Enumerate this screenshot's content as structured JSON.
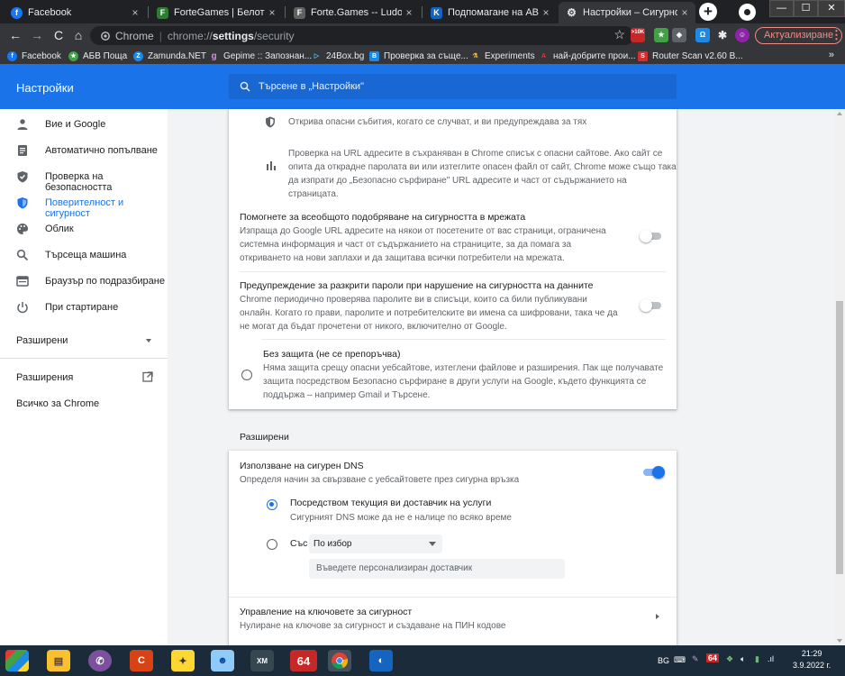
{
  "window": {
    "tabs": [
      {
        "title": "Facebook",
        "favicon": "facebook-favicon",
        "favicon_color": "#1877f2",
        "favicon_char": "f"
      },
      {
        "title": "ForteGames | Белот Играй",
        "favicon": "fortegames-favicon",
        "favicon_color": "#2e7d32",
        "favicon_char": "F"
      },
      {
        "title": "Forte.Games -- Ludo --",
        "favicon": "fortegames-ludo-favicon",
        "favicon_color": "#616161",
        "favicon_char": "F"
      },
      {
        "title": "Подпомагане на АВ прогр",
        "favicon": "k-favicon",
        "favicon_color": "#1565c0",
        "favicon_char": "K"
      },
      {
        "title": "Настройки – Сигурност",
        "favicon": "settings-gear-favicon",
        "favicon_color": "#5f6368",
        "favicon_char": "⚙"
      }
    ],
    "tab_close_glyph": "×",
    "new_tab_glyph": "+",
    "window_controls": {
      "minimize": "—",
      "maximize": "☐",
      "close": "✕"
    }
  },
  "toolbar": {
    "origin_label": "Chrome",
    "url_scheme": "chrome://",
    "url_host": "settings",
    "url_path": "/security",
    "update_label": "Актуализиране",
    "menu_glyph": "⋮",
    "badge_text": ">10K"
  },
  "bookmarks": [
    {
      "label": "Facebook",
      "color": "#1877f2",
      "char": "f"
    },
    {
      "label": "АБВ Поща",
      "color": "#43a047",
      "char": "★"
    },
    {
      "label": "Zamunda.NET",
      "color": "#1e88e5",
      "char": "Z"
    },
    {
      "label": "Gepime :: Запознан...",
      "color": "#ab47bc",
      "char": "g"
    },
    {
      "label": "24Box.bg",
      "color": "#039be5",
      "char": "▷"
    },
    {
      "label": "Проверка за същe...",
      "color": "#1e88e5",
      "char": "B"
    },
    {
      "label": "Experiments",
      "color": "#fbc02d",
      "char": "⚗"
    },
    {
      "label": "най-добрите прои...",
      "color": "#e53935",
      "char": "A"
    },
    {
      "label": "Router Scan v2.60 B...",
      "color": "#d32f2f",
      "char": "S"
    }
  ],
  "bookmarks_more": "»",
  "settings": {
    "title": "Настройки",
    "search_placeholder": "Търсене в „Настройки\""
  },
  "sidenav": {
    "items": [
      {
        "label": "Вие и Google",
        "icon": "person-icon"
      },
      {
        "label": "Автоматично попълване",
        "icon": "autofill-icon"
      },
      {
        "label": "Проверка на безопасността",
        "icon": "safety-check-shield-icon"
      },
      {
        "label": "Поверителност и сигурност",
        "icon": "privacy-shield-icon",
        "active": true
      },
      {
        "label": "Облик",
        "icon": "palette-icon"
      },
      {
        "label": "Търсеща машина",
        "icon": "search-icon"
      },
      {
        "label": "Браузър по подразбиране",
        "icon": "browser-icon"
      },
      {
        "label": "При стартиране",
        "icon": "power-icon"
      }
    ],
    "advanced_label": "Разширени",
    "extensions_label": "Разширения",
    "about_label": "Всичко за Chrome"
  },
  "content": {
    "enhanced_line1": "Открива опасни събития, когато се случват, и ви предупреждава за тях",
    "enhanced_line2": [
      "Проверка на URL адресите в съхраняван в Chrome списък с опасни сайтове. Ако сайт се",
      "опита да открадне паролата ви или изтеглите опасен файл от сайт, Chrome може също така",
      "да изпрати до „Безопасно сърфиране\" URL адресите и част от съдържанието на страницата."
    ],
    "help_improve": {
      "title": "Помогнете за всеобщото подобряване на сигурността в мрежата",
      "desc": [
        "Изпраща до Google URL адресите на някои от посетените от вас страници, ограничена",
        "системна информация и част от съдържанието на страниците, за да помага за",
        "откриването на нови заплахи и да защитава всички потребители на мрежата."
      ],
      "enabled": false
    },
    "password_leak": {
      "title": "Предупреждение за разкрити пароли при нарушение на сигурността на данните",
      "desc": [
        "Chrome периодично проверява паролите ви в списъци, които са били публикувани",
        "онлайн. Когато го прави, паролите и потребителските ви имена са шифровани, така че да",
        "не могат да бъдат прочетени от никого, включително от Google."
      ],
      "enabled": false
    },
    "no_protection": {
      "title": "Без защита (не се препоръчва)",
      "desc": [
        "Няма защита срещу опасни уебсайтове, изтеглени файлове и разширения. Пак ще получавате",
        "защита посредством Безопасно сърфиране в други услуги на Google, където функцията се",
        "поддържа – например Gmail и Търсене."
      ]
    },
    "advanced_header": "Разширени",
    "secure_dns": {
      "title": "Използване на сигурен DNS",
      "desc": "Определя начин за свързване с уебсайтовете през сигурна връзка",
      "enabled": true,
      "option_current_title": "Посредством текущия ви доставчик на услуги",
      "option_current_desc": "Сигурният DNS може да не е налице по всяко време",
      "option_with_label": "Със",
      "select_value": "По избор",
      "custom_placeholder": "Въведете персонализиран доставчик"
    },
    "security_keys": {
      "title": "Управление на ключовете за сигурност",
      "desc": "Нулиране на ключове за сигурност и създаване на ПИН кодове"
    }
  },
  "taskbar": {
    "lang": "BG",
    "counter_badge": "64",
    "time": "21:29",
    "date": "3.9.2022 г."
  },
  "colors": {
    "accent": "#1a73e8",
    "toggle_on": "#1a73e8",
    "header_bg": "#1a73e8"
  }
}
